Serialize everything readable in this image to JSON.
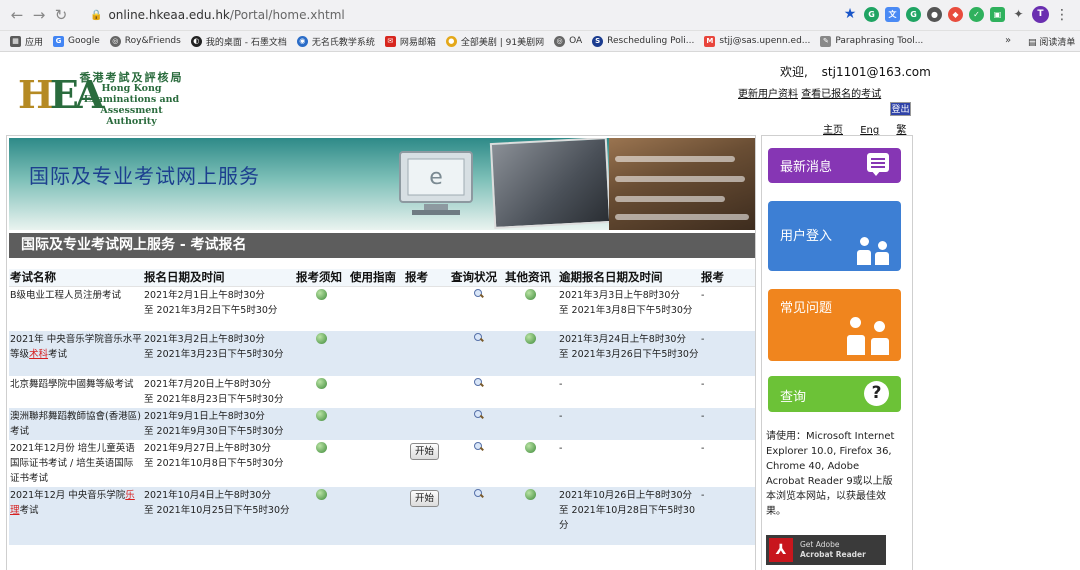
{
  "browser": {
    "url_host": "online.hkeaa.edu.hk",
    "url_path": "/Portal/home.xhtml",
    "profile_letter": "T",
    "bookmarks": [
      "应用",
      "Google",
      "Roy&Friends",
      "我的桌面 - 石墨文档",
      "无名氏教学系统",
      "网易邮箱",
      "全部美剧 | 91美剧网",
      "OA",
      "Rescheduling Poli...",
      "stjj@sas.upenn.ed...",
      "Paraphrasing Tool..."
    ],
    "bookmarks_more": "»",
    "reading_list": "阅读清单"
  },
  "logo": {
    "mark": "EA",
    "mark_h": "H",
    "zh": "香港考試及評核局",
    "en_lines": [
      "Hong Kong",
      "Examinations and",
      "Assessment Authority"
    ]
  },
  "header": {
    "welcome": "欢迎,",
    "user_email": "stj1101@163.com",
    "update_info": "更新用户资料",
    "view_registered": "查看已报名的考试",
    "logout": "登出",
    "lang_home": "主页",
    "lang_eng": "Eng",
    "lang_trad": "繁"
  },
  "banner": {
    "title": "国际及专业考试网上服务",
    "monitor_letter": "e"
  },
  "section_title": "国际及专业考试网上服务 - 考试报名",
  "table": {
    "headers": [
      "考试名称",
      "报名日期及时间",
      "报考须知",
      "使用指南",
      "报考",
      "查询状况",
      "其他资讯",
      "逾期报名日期及时间",
      "报考"
    ],
    "rows": [
      {
        "name_pre": "B级电业工程人员注册考试",
        "name_hl": "",
        "name_post": "",
        "reg_start": "2021年2月1日上午8时30分",
        "reg_end": "至 2021年3月2日下午5时30分",
        "notice": true,
        "apply_btn": "",
        "late_start": "2021年3月3日上午8时30分",
        "late_end": "至 2021年3月8日下午5时30分",
        "last": "-"
      },
      {
        "name_pre": "2021年 中央音乐学院音乐水平等级",
        "name_hl": "术科",
        "name_post": "考试",
        "reg_start": "2021年3月2日上午8时30分",
        "reg_end": "至 2021年3月23日下午5时30分",
        "notice": true,
        "apply_btn": "",
        "late_start": "2021年3月24日上午8时30分",
        "late_end": "至 2021年3月26日下午5时30分",
        "last": "-"
      },
      {
        "name_pre": "北京舞蹈學院中國舞等級考试",
        "name_hl": "",
        "name_post": "",
        "reg_start": "2021年7月20日上午8时30分",
        "reg_end": "至 2021年8月23日下午5时30分",
        "notice": true,
        "apply_btn": "",
        "late_start": "-",
        "late_end": "",
        "last": "-"
      },
      {
        "name_pre": "澳洲聯邦舞蹈教師協會(香港區)考试",
        "name_hl": "",
        "name_post": "",
        "reg_start": "2021年9月1日上午8时30分",
        "reg_end": "至 2021年9月30日下午5时30分",
        "notice": true,
        "apply_btn": "",
        "late_start": "-",
        "late_end": "",
        "last": "-"
      },
      {
        "name_pre": "2021年12月份 培生儿童英语国际证书考试 / 培生英语国际证书考试",
        "name_hl": "",
        "name_post": "",
        "reg_start": "2021年9月27日上午8时30分",
        "reg_end": "至 2021年10月8日下午5时30分",
        "notice": true,
        "apply_btn": "开始",
        "late_start": "-",
        "late_end": "",
        "last": "-"
      },
      {
        "name_pre": "2021年12月 中央音乐学院",
        "name_hl": "乐理",
        "name_post": "考试",
        "reg_start": "2021年10月4日上午8时30分",
        "reg_end": "至 2021年10月25日下午5时30分",
        "notice": true,
        "apply_btn": "开始",
        "late_start": "2021年10月26日上午8时30分",
        "late_end": "至 2021年10月28日下午5时30分",
        "last": "-"
      }
    ]
  },
  "sidebar": {
    "news": "最新消息",
    "login": "用户登入",
    "faq": "常见问题",
    "query": "查询",
    "query_icon": "?",
    "note": "请使用：Microsoft Internet Explorer 10.0, Firefox 36, Chrome 40, Adobe Acrobat Reader 9或以上版本浏览本网站，以获最佳效果。",
    "adobe_line1": "Get Adobe",
    "adobe_line2": "Acrobat Reader"
  },
  "colors": {
    "news_tile": "#8636b4",
    "login_tile": "#3d7fd4",
    "faq_tile": "#f0851e",
    "query_tile": "#6cc237",
    "section_bar": "#5d5d5d",
    "banner_title": "#1c3f8f",
    "row_alt": "#dfe9f4"
  },
  "icons": {
    "notice": "globe-icon",
    "status": "magnifier-icon",
    "other_info": "globe-icon"
  }
}
